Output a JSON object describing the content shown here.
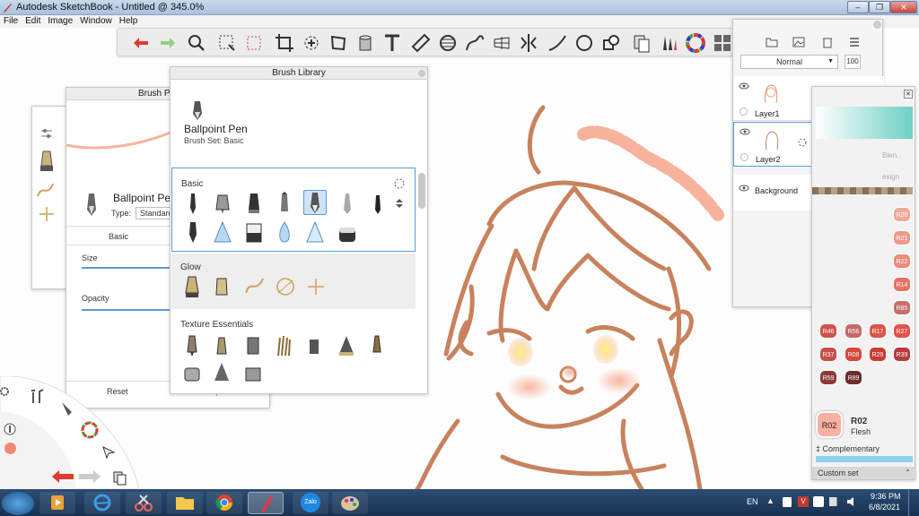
{
  "window": {
    "title": "Autodesk SketchBook - Untitled @ 345.0%"
  },
  "menu": [
    "File",
    "Edit",
    "Image",
    "Window",
    "Help"
  ],
  "brush_properties": {
    "title": "Brush Pr",
    "brush_name": "Ballpoint Pe",
    "type_label": "Type:",
    "type_value": "Standard",
    "tab_basic": "Basic",
    "size_label": "Size",
    "opacity_label": "Opacity",
    "reset_label": "Reset",
    "export_label": "Export"
  },
  "brush_library": {
    "title": "Brush Library",
    "current_brush": "Ballpoint Pen",
    "brush_set": "Brush Set: Basic",
    "sections": [
      "Basic",
      "Glow",
      "Texture Essentials"
    ]
  },
  "layers": {
    "blend_mode": "Normal",
    "opacity": "100",
    "items": [
      "Layer1",
      "Layer2",
      "Background"
    ]
  },
  "copic": {
    "partial_label_1": "Blen..",
    "partial_label_2": "esign",
    "swatches": [
      {
        "code": "R20",
        "color": "#f2a89a"
      },
      {
        "code": "R21",
        "color": "#ef9b8c"
      },
      {
        "code": "R22",
        "color": "#ec8b7c"
      },
      {
        "code": "R14",
        "color": "#e57362"
      },
      {
        "code": "R85",
        "color": "#c4706e"
      },
      {
        "code": "R46",
        "color": "#d0534c"
      },
      {
        "code": "R56",
        "color": "#c46a68"
      },
      {
        "code": "R17",
        "color": "#db5545"
      },
      {
        "code": "R27",
        "color": "#e0544b"
      },
      {
        "code": "R37",
        "color": "#c5504b"
      },
      {
        "code": "R08",
        "color": "#d9473d"
      },
      {
        "code": "R29",
        "color": "#c93b36"
      },
      {
        "code": "R39",
        "color": "#b83a3c"
      },
      {
        "code": "R59",
        "color": "#8d3a3a"
      },
      {
        "code": "R89",
        "color": "#6e2c2e"
      }
    ],
    "selected_code": "R02",
    "selected_name": "Flesh",
    "selected_color": "#f8b0a0",
    "complementary_label": "Complementary",
    "custom_set_label": "Custom set"
  },
  "taskbar": {
    "language": "EN",
    "time": "9:36 PM",
    "date": "6/8/2021",
    "zalo_label": "Zalo"
  },
  "accent_colors": {
    "stroke": "#c8825d",
    "peach": "#f6a58a"
  }
}
